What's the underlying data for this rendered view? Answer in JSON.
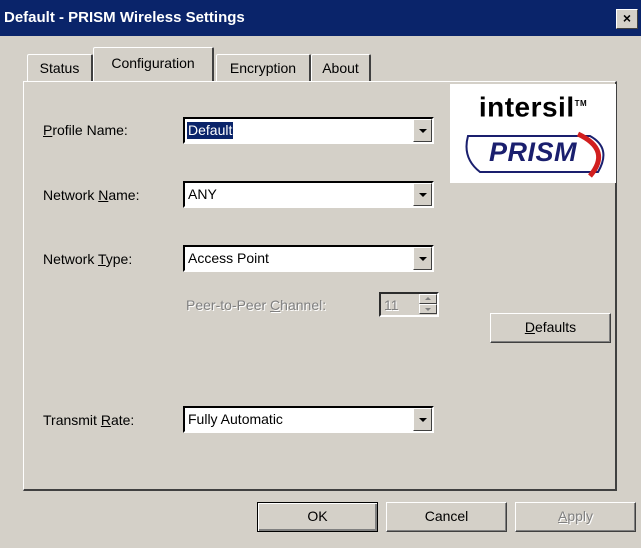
{
  "window": {
    "title": "Default - PRISM Wireless Settings",
    "close_glyph": "×"
  },
  "tabs": [
    {
      "label": "Status",
      "active": false
    },
    {
      "label": "Configuration",
      "active": true
    },
    {
      "label": "Encryption",
      "active": false
    },
    {
      "label": "About",
      "active": false
    }
  ],
  "form": {
    "profile_name": {
      "label_pre": "",
      "label_accel": "P",
      "label_post": "rofile Name:",
      "value": "Default"
    },
    "network_name": {
      "label_pre": "Network ",
      "label_accel": "N",
      "label_post": "ame:",
      "value": "ANY"
    },
    "network_type": {
      "label_pre": "Network ",
      "label_accel": "T",
      "label_post": "ype:",
      "value": "Access Point"
    },
    "peer_channel": {
      "label_pre": "Peer-to-Peer ",
      "label_accel": "C",
      "label_post": "hannel:",
      "value": "11"
    },
    "transmit_rate": {
      "label_pre": "Transmit ",
      "label_accel": "R",
      "label_post": "ate:",
      "value": "Fully Automatic"
    }
  },
  "logo": {
    "company": "intersil",
    "tm": "TM",
    "product": "PRISM"
  },
  "buttons": {
    "defaults_accel": "D",
    "defaults_rest": "efaults",
    "ok": "OK",
    "cancel": "Cancel",
    "apply_accel": "A",
    "apply_rest": "pply"
  },
  "colors": {
    "titlebar": "#0a246a",
    "face": "#d4d0c8",
    "prism_blue": "#1a1f6e",
    "prism_red": "#d11f1f"
  }
}
